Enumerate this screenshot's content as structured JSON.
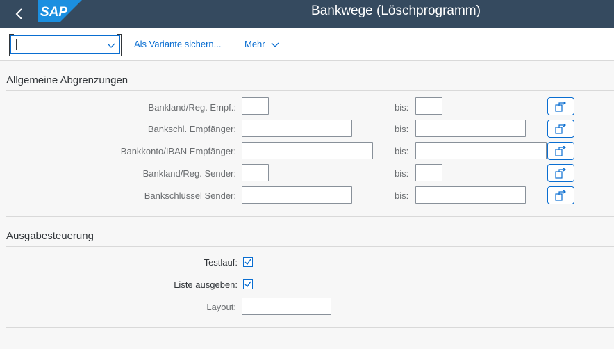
{
  "shell": {
    "title": "Bankwege (Löschprogramm)",
    "logo_text": "SAP",
    "back_icon": "chevron-left-icon",
    "brand_color": "#0a6ed1",
    "shell_color": "#354a5f"
  },
  "toolbar": {
    "variant_value": "",
    "save_variant_label": "Als Variante sichern...",
    "more_label": "Mehr"
  },
  "section_general": {
    "title": "Allgemeine Abgrenzungen",
    "rows": [
      {
        "label": "Bankland/Reg. Empf.:",
        "from": "",
        "bis": "bis:",
        "to": ""
      },
      {
        "label": "Bankschl. Empfänger:",
        "from": "",
        "bis": "bis:",
        "to": ""
      },
      {
        "label": "Bankkonto/IBAN Empfänger:",
        "from": "",
        "bis": "bis:",
        "to": ""
      },
      {
        "label": "Bankland/Reg. Sender:",
        "from": "",
        "bis": "bis:",
        "to": ""
      },
      {
        "label": "Bankschlüssel Sender:",
        "from": "",
        "bis": "bis:",
        "to": ""
      }
    ],
    "multiple_selection_icon": "multiple-selection-icon"
  },
  "section_output": {
    "title": "Ausgabesteuerung",
    "testlauf_label": "Testlauf:",
    "testlauf_checked": true,
    "liste_label": "Liste ausgeben:",
    "liste_checked": true,
    "layout_label": "Layout:",
    "layout_value": ""
  }
}
